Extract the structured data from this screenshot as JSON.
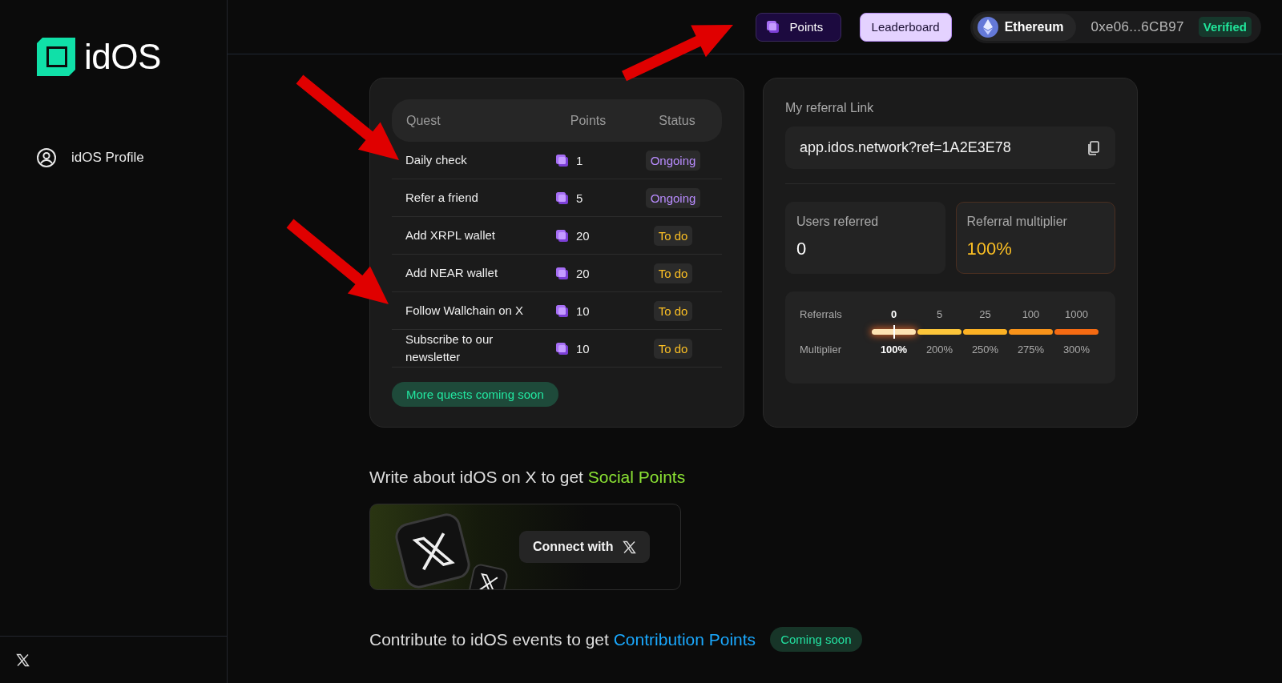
{
  "sidebar": {
    "logo_text": "idOS",
    "items": [
      {
        "label": "idOS Profile"
      }
    ]
  },
  "header": {
    "nav": [
      {
        "label": "Points",
        "selected": true,
        "has_icon": true
      },
      {
        "label": "Leaderboard",
        "selected": false,
        "has_icon": false
      }
    ],
    "wallet": {
      "network": "Ethereum",
      "address": "0xe06...6CB97",
      "badge": "Verified"
    }
  },
  "quests": {
    "columns": [
      "Quest",
      "Points",
      "Status"
    ],
    "rows": [
      {
        "quest": "Daily check",
        "points": "1",
        "status": "Ongoing",
        "color": "#b98cff"
      },
      {
        "quest": "Refer a friend",
        "points": "5",
        "status": "Ongoing",
        "color": "#b98cff"
      },
      {
        "quest": "Add XRPL wallet",
        "points": "20",
        "status": "To do",
        "color": "#fbbf24"
      },
      {
        "quest": "Add NEAR wallet",
        "points": "20",
        "status": "To do",
        "color": "#fbbf24"
      },
      {
        "quest": "Follow Wallchain on X",
        "points": "10",
        "status": "To do",
        "color": "#fbbf24"
      },
      {
        "quest": "Subscribe to our newsletter",
        "points": "10",
        "status": "To do",
        "color": "#fbbf24"
      }
    ],
    "more_badge": "More quests coming soon"
  },
  "referral": {
    "title": "My referral Link",
    "link": "app.idos.network?ref=1A2E3E78",
    "stats": [
      {
        "label": "Users referred",
        "value": "0",
        "highlighted": false
      },
      {
        "label": "Referral multiplier",
        "value": "100%",
        "highlighted": true
      }
    ],
    "tiers": {
      "row_labels": [
        "Referrals",
        "Multiplier"
      ],
      "items": [
        {
          "referrals": "0",
          "multiplier": "100%",
          "selected": true,
          "color": "#fde3b3"
        },
        {
          "referrals": "5",
          "multiplier": "200%",
          "selected": false,
          "color": "#fbc53a"
        },
        {
          "referrals": "25",
          "multiplier": "250%",
          "selected": false,
          "color": "#fbb124"
        },
        {
          "referrals": "100",
          "multiplier": "275%",
          "selected": false,
          "color": "#f8931a"
        },
        {
          "referrals": "1000",
          "multiplier": "300%",
          "selected": false,
          "color": "#f56a12"
        }
      ]
    }
  },
  "social": {
    "prefix": "Write about idOS on X to get",
    "highlight": "Social Points",
    "connect_button": "Connect with"
  },
  "contribution": {
    "prefix": "Contribute to idOS events to get",
    "highlight": "Contribution Points",
    "badge": "Coming soon"
  }
}
